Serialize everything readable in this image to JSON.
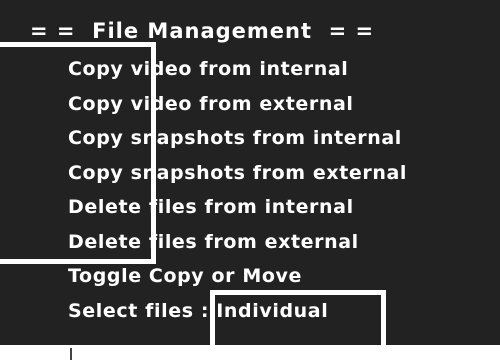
{
  "screen": {
    "title": "= =  File Management  = =",
    "menu": [
      {
        "label": "Copy video from internal"
      },
      {
        "label": "Copy video from external"
      },
      {
        "label": "Copy snapshots from internal"
      },
      {
        "label": "Copy snapshots from external"
      },
      {
        "label": "Delete files from internal"
      },
      {
        "label": "Delete files from external"
      },
      {
        "label": "Toggle Copy or Move"
      }
    ],
    "select_files": {
      "label": "Select files",
      "separator": " : ",
      "value": "Individual"
    }
  },
  "colors": {
    "panel_background": "#222222",
    "text": "#ffffff",
    "overlay_border": "#ffffff"
  }
}
